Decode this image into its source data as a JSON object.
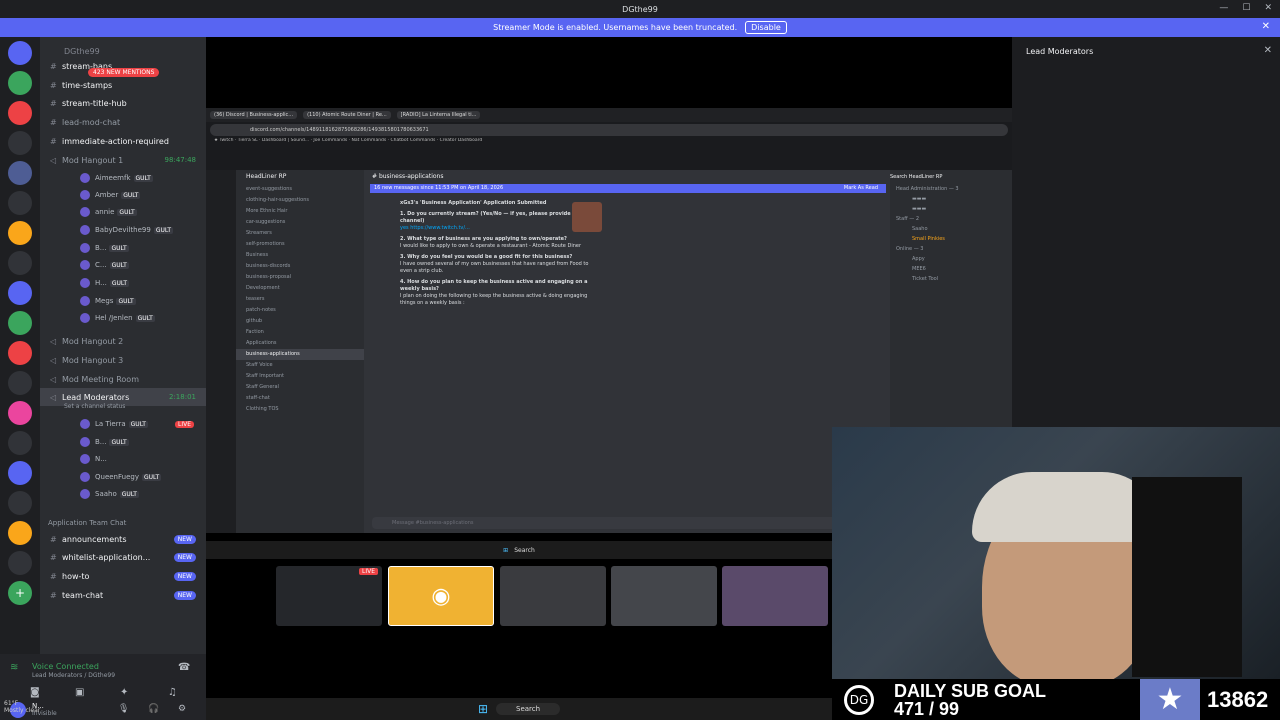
{
  "window": {
    "title": "DGthe99"
  },
  "banner": {
    "text": "Streamer Mode is enabled. Usernames have been truncated.",
    "button": "Disable"
  },
  "server": {
    "name": "DGthe99",
    "mentions": "423 NEW MENTIONS"
  },
  "channels": [
    {
      "name": "stream-bans",
      "unread": true
    },
    {
      "name": "time-stamps",
      "unread": true
    },
    {
      "name": "stream-title-hub",
      "unread": true
    },
    {
      "name": "lead-mod-chat",
      "unread": false
    },
    {
      "name": "immediate-action-required",
      "unread": true
    }
  ],
  "voice1": {
    "name": "Mod Hangout 1",
    "time": "98:47:48",
    "users": [
      "Aimeemfk",
      "Amber",
      "annie",
      "BabyDevilthe99",
      "B...",
      "C...",
      "H...",
      "Megs",
      "Hel /Jenlen"
    ]
  },
  "voice_others": [
    "Mod Hangout 2",
    "Mod Hangout 3",
    "Mod Meeting Room"
  ],
  "lead": {
    "name": "Lead Moderators",
    "time": "2:18:01",
    "status": "Set a channel status",
    "users": [
      "La Tierra",
      "B...",
      "N...",
      "QueenFuegy",
      "Saaho"
    ],
    "live": "LIVE"
  },
  "category": "Application Team Chat",
  "team_channels": [
    {
      "name": "announcements",
      "badge": "NEW"
    },
    {
      "name": "whitelist-application...",
      "badge": "NEW"
    },
    {
      "name": "how-to",
      "badge": "NEW"
    },
    {
      "name": "team-chat",
      "badge": "NEW"
    }
  ],
  "voice_connected": {
    "title": "Voice Connected",
    "sub": "Lead Moderators / DGthe99"
  },
  "user": {
    "name": "N...",
    "status": "Invisible"
  },
  "weather": {
    "temp": "61°F",
    "desc": "Mostly clear"
  },
  "right_panel": {
    "title": "Lead Moderators"
  },
  "stream": {
    "tabs": [
      "(36) Discord | Business-applic...",
      "(110) Atomic Route Diner | Re...",
      "[RADIO] La Linterna Illegal ti..."
    ],
    "url": "discord.com/channels/1489118162875068286/1493815801780633671",
    "server": "HeadLiner RP",
    "channel": "business-applications",
    "newbar": "16 new messages since 11:53 PM on April 18, 2026",
    "mark": "Mark As Read",
    "search": "Search HeadLiner RP",
    "sidebar": [
      "event-suggestions",
      "clothing-hair-suggestions",
      "More Ethnic Hair",
      "car-suggestions",
      "Streamers",
      "self-promotions",
      "Business",
      "business-discords",
      "business-proposal",
      "Development",
      "teasers",
      "patch-notes",
      "github",
      "Faction",
      "Applications",
      "business-applications",
      "Staff Voice",
      "Staff Important",
      "Staff General",
      "staff-chat",
      "Clothing TOS"
    ],
    "message": {
      "title": "xGs3's 'Business Application' Application Submitted",
      "q1": "1. Do you currently stream? (Yes/No — if yes, please provide your channel)",
      "a1": "yes  https://www.twitch.tv/...",
      "q2": "2. What type of business are you applying to own/operate?",
      "a2": "I would like to apply to own & operate a restaurant - Atomic Route Diner",
      "q3": "3. Why do you feel you would be a good fit for this business?",
      "a3": "I have owned several of my own businesses that have ranged from Food to even a strip club.",
      "q4": "4. How do you plan to keep the business active and engaging on a weekly basis?",
      "a4": "I plan on doing the following to keep the business active & doing engaging things on a weekly basis :"
    },
    "members": [
      "Head Administration — 3",
      "Staff — 2",
      "Saaho",
      "Small Pinkies",
      "Online — 3",
      "Appy",
      "MEE6",
      "Ticket Tool"
    ],
    "composer": "Message #business-applications"
  },
  "thumb_live": "LIVE",
  "sub_goal": {
    "label": "DAILY SUB GOAL",
    "progress": "471 / 99",
    "count": "13862"
  },
  "taskbar": {
    "search": "Search"
  }
}
